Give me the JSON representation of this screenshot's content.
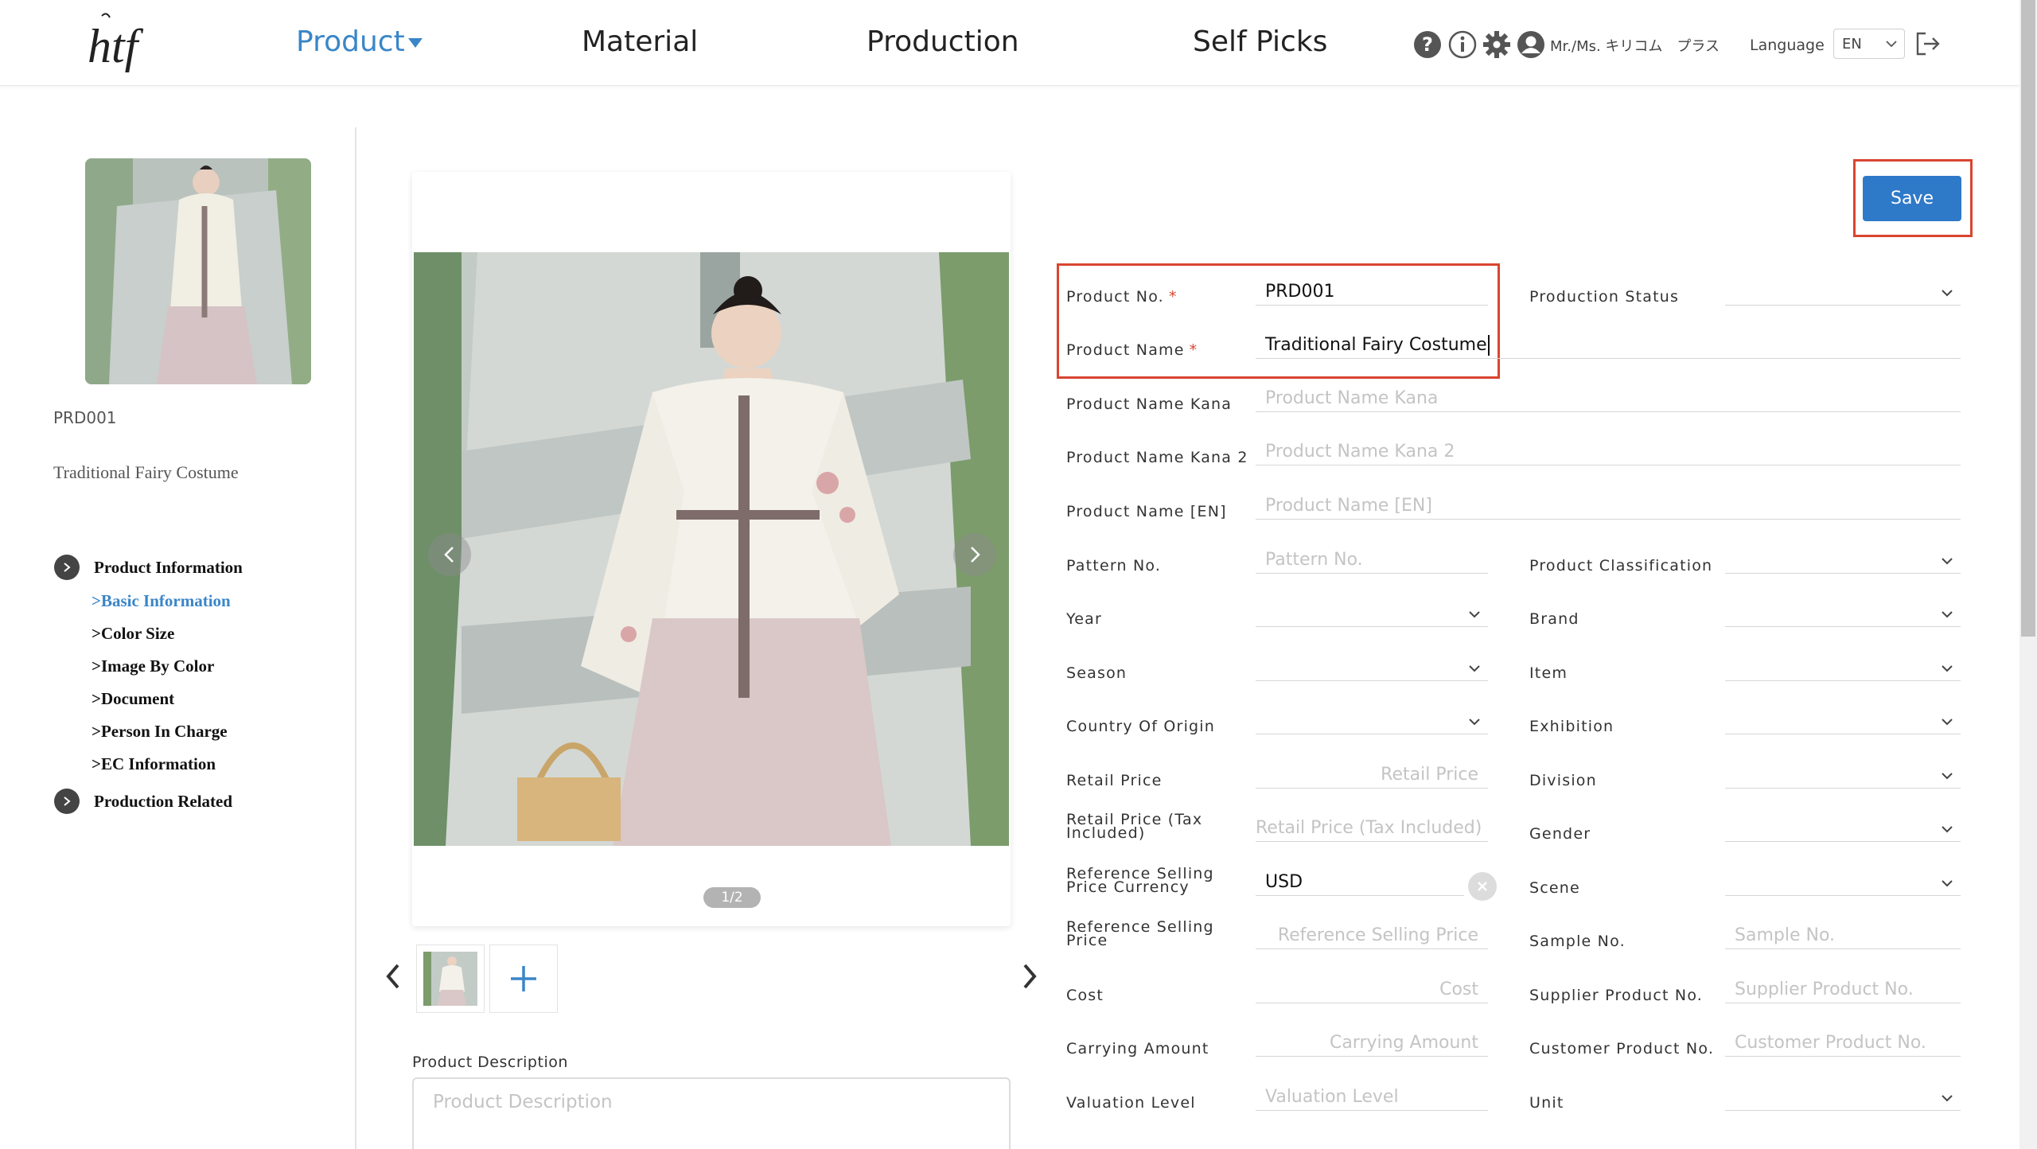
{
  "header": {
    "nav": [
      {
        "label": "Product",
        "active": true
      },
      {
        "label": "Material"
      },
      {
        "label": "Production"
      },
      {
        "label": "Self Picks"
      }
    ],
    "icons": [
      "help-icon",
      "info-icon",
      "gear-icon",
      "user-icon",
      "logout-icon"
    ],
    "user_name": "Mr./Ms. キリコム　プラス",
    "language_label": "Language",
    "language_value": "EN"
  },
  "sidebar": {
    "product_code": "PRD001",
    "product_name": "Traditional Fairy Costume",
    "groups": [
      {
        "label": "Product Information",
        "items": [
          {
            "label": "Basic Information",
            "active": true
          },
          {
            "label": "Color Size"
          },
          {
            "label": "Image By Color"
          },
          {
            "label": "Document"
          },
          {
            "label": "Person In Charge"
          },
          {
            "label": "EC Information"
          }
        ]
      },
      {
        "label": "Production Related"
      }
    ]
  },
  "gallery": {
    "pager": "1/2",
    "description_label": "Product Description",
    "description_placeholder": "Product Description"
  },
  "form": {
    "save_label": "Save",
    "product_no": {
      "label": "Product No.",
      "value": "PRD001"
    },
    "production_status": {
      "label": "Production Status"
    },
    "product_name": {
      "label": "Product Name",
      "value": "Traditional Fairy Costume"
    },
    "product_name_kana": {
      "label": "Product Name Kana",
      "placeholder": "Product Name Kana"
    },
    "product_name_kana2": {
      "label": "Product Name Kana 2",
      "placeholder": "Product Name Kana 2"
    },
    "product_name_en": {
      "label": "Product Name [EN]",
      "placeholder": "Product Name [EN]"
    },
    "pattern_no": {
      "label": "Pattern No.",
      "placeholder": "Pattern No."
    },
    "product_classification": {
      "label": "Product Classification"
    },
    "year": {
      "label": "Year"
    },
    "brand": {
      "label": "Brand"
    },
    "season": {
      "label": "Season"
    },
    "item": {
      "label": "Item"
    },
    "country_of_origin": {
      "label": "Country Of Origin"
    },
    "exhibition": {
      "label": "Exhibition"
    },
    "retail_price": {
      "label": "Retail Price",
      "placeholder": "Retail Price"
    },
    "division": {
      "label": "Division"
    },
    "retail_price_tax": {
      "label": "Retail Price (Tax Included)",
      "placeholder": "Retail Price (Tax Included)"
    },
    "gender": {
      "label": "Gender"
    },
    "ref_currency": {
      "label": "Reference Selling Price Currency",
      "value": "USD"
    },
    "scene": {
      "label": "Scene"
    },
    "ref_price": {
      "label": "Reference Selling Price",
      "placeholder": "Reference Selling Price"
    },
    "sample_no": {
      "label": "Sample No.",
      "placeholder": "Sample No."
    },
    "cost": {
      "label": "Cost",
      "placeholder": "Cost"
    },
    "supplier_product_no": {
      "label": "Supplier Product No.",
      "placeholder": "Supplier Product No."
    },
    "carrying_amount": {
      "label": "Carrying Amount",
      "placeholder": "Carrying Amount"
    },
    "customer_product_no": {
      "label": "Customer Product No.",
      "placeholder": "Customer Product No."
    },
    "valuation_level": {
      "label": "Valuation Level",
      "placeholder": "Valuation Level"
    },
    "unit": {
      "label": "Unit"
    }
  },
  "colors": {
    "accent": "#3a86c8",
    "save": "#2f79c9",
    "highlight": "#d9452f"
  }
}
